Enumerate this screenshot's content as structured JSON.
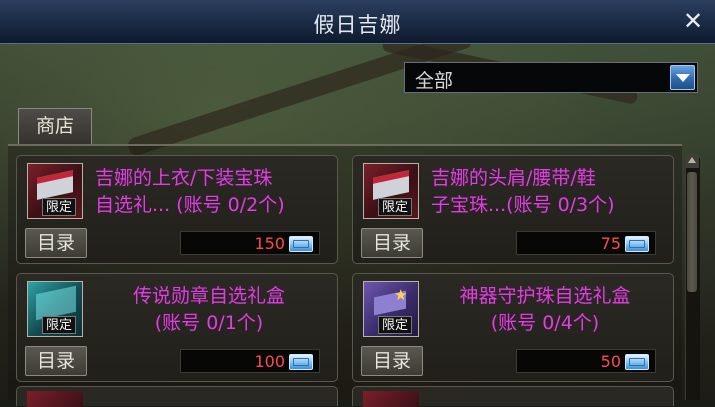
{
  "window": {
    "title": "假日吉娜",
    "close_label": "✕"
  },
  "filter": {
    "selected": "全部"
  },
  "tabs": [
    {
      "label": "商店"
    }
  ],
  "items": [
    {
      "name_lines": [
        "吉娜的上衣/下装宝珠",
        "自选礼... (账号 0/2个)"
      ],
      "badge": "限定",
      "catalog_label": "目录",
      "price": "150",
      "icon": "red-gift-box-icon"
    },
    {
      "name_lines": [
        "吉娜的头肩/腰带/鞋",
        "子宝珠...(账号 0/3个)"
      ],
      "badge": "限定",
      "catalog_label": "目录",
      "price": "75",
      "icon": "red-gift-box-icon"
    },
    {
      "name_lines": [
        "传说勋章自选礼盒",
        "(账号 0/1个)"
      ],
      "badge": "限定",
      "catalog_label": "目录",
      "price": "100",
      "icon": "teal-gift-box-icon"
    },
    {
      "name_lines": [
        "神器守护珠自选礼盒",
        "(账号 0/4个)"
      ],
      "badge": "限定",
      "catalog_label": "目录",
      "price": "50",
      "icon": "purple-gift-box-icon"
    }
  ],
  "colors": {
    "item_name": "#e43be6",
    "price": "#ff4a4a",
    "title_bar": "#1a2a44"
  }
}
